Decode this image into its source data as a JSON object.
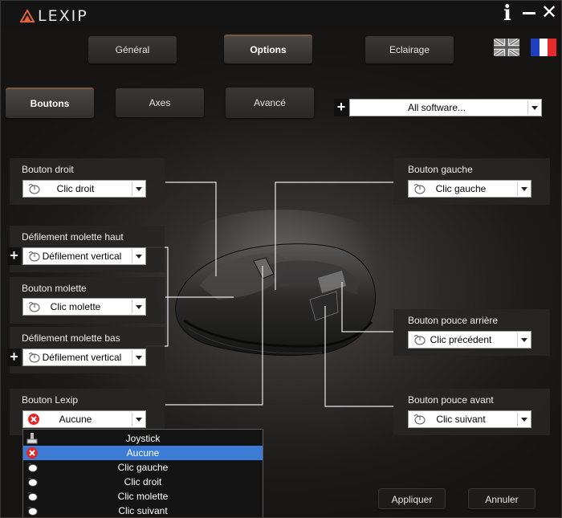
{
  "app": {
    "title": "LEXIP"
  },
  "tabs": [
    {
      "label": "Général",
      "active": false
    },
    {
      "label": "Options",
      "active": true
    },
    {
      "label": "Eclairage",
      "active": false
    }
  ],
  "subtabs": [
    {
      "label": "Boutons",
      "active": true
    },
    {
      "label": "Axes",
      "active": false
    },
    {
      "label": "Avancé",
      "active": false
    }
  ],
  "software_select": {
    "value": "All software..."
  },
  "languages": [
    "english-flag",
    "french-flag"
  ],
  "panels": {
    "right_button": {
      "title": "Bouton droit",
      "value": "Clic droit",
      "icon": "mouse-icon"
    },
    "wheel_up": {
      "title": "Défilement molette haut",
      "value": "Défilement vertical",
      "icon": "mouse-icon"
    },
    "wheel_button": {
      "title": "Bouton molette",
      "value": "Clic molette",
      "icon": "mouse-icon"
    },
    "wheel_down": {
      "title": "Défilement molette bas",
      "value": "Défilement vertical",
      "icon": "mouse-icon"
    },
    "lexip_button": {
      "title": "Bouton Lexip",
      "value": "Aucune",
      "icon": "none-icon"
    },
    "left_button": {
      "title": "Bouton gauche",
      "value": "Clic gauche",
      "icon": "mouse-icon"
    },
    "thumb_back": {
      "title": "Bouton pouce arrière",
      "value": "Clic précédent",
      "icon": "mouse-icon"
    },
    "thumb_forward": {
      "title": "Bouton pouce avant",
      "value": "Clic suivant",
      "icon": "mouse-icon"
    }
  },
  "dropdown_options": [
    {
      "label": "Joystick",
      "icon": "joystick-icon",
      "selected": false
    },
    {
      "label": "Aucune",
      "icon": "none-icon",
      "selected": true
    },
    {
      "label": "Clic gauche",
      "icon": "mouse-icon",
      "selected": false
    },
    {
      "label": "Clic droit",
      "icon": "mouse-icon",
      "selected": false
    },
    {
      "label": "Clic molette",
      "icon": "mouse-icon",
      "selected": false
    },
    {
      "label": "Clic suivant",
      "icon": "mouse-icon",
      "selected": false
    }
  ],
  "footer": {
    "apply": "Appliquer",
    "cancel": "Annuler"
  },
  "colors": {
    "accent": "#ff9a5a",
    "selection": "#3c7bd6",
    "panel": "#2a2827"
  }
}
